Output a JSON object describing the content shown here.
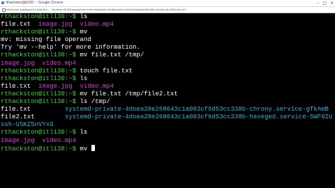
{
  "window": {
    "title": "rthackston@itl130: ~ Google Chrome",
    "url": "shell.learn.gold/apps/rt.instruction... ?student=itl130&arrangement=terminal&pwd=ssh&session=shell-rthackston&profile=tmux&cols=80&rows=24",
    "controls": [
      "–",
      "□",
      "×"
    ]
  },
  "colors": {
    "prompt": "#3fd13f",
    "file_magenta": "#d63cd6",
    "file_cyan": "#2fb4d8",
    "background": "#000000"
  },
  "terminal": {
    "lines": [
      {
        "prompt": "rthackston@itl130:~$",
        "cmd": " ls"
      },
      {
        "files": [
          {
            "t": "file.txt",
            "c": "plain"
          },
          {
            "t": "  ",
            "c": "plain"
          },
          {
            "t": "image.jpg",
            "c": "magenta"
          },
          {
            "t": "  ",
            "c": "plain"
          },
          {
            "t": "video.mp4",
            "c": "magenta"
          }
        ]
      },
      {
        "prompt": "rthackston@itl130:~$",
        "cmd": " mv"
      },
      {
        "text": "mv: missing file operand"
      },
      {
        "text": "Try 'mv --help' for more information."
      },
      {
        "prompt": "rthackston@itl130:~$",
        "cmd": " mv file.txt /tmp/"
      },
      {
        "files": [
          {
            "t": "image.jpg",
            "c": "magenta"
          },
          {
            "t": "  ",
            "c": "plain"
          },
          {
            "t": "video.mp4",
            "c": "magenta"
          }
        ]
      },
      {
        "prompt": "rthackston@itl130:~$",
        "cmd": " touch file.txt"
      },
      {
        "prompt": "rthackston@itl130:~$",
        "cmd": " ls"
      },
      {
        "files": [
          {
            "t": "file.txt",
            "c": "plain"
          },
          {
            "t": "  ",
            "c": "plain"
          },
          {
            "t": "image.jpg",
            "c": "magenta"
          },
          {
            "t": "  ",
            "c": "plain"
          },
          {
            "t": "video.mp4",
            "c": "magenta"
          }
        ]
      },
      {
        "prompt": "rthackston@itl130:~$",
        "cmd": " mv file.txt /tmp/file2.txt"
      },
      {
        "prompt": "rthackston@itl130:~$",
        "cmd": " ls /tmp/"
      },
      {
        "files": [
          {
            "t": "file.txt",
            "c": "plain"
          },
          {
            "t": "         ",
            "c": "plain"
          },
          {
            "t": "systemd-private-4doea28e268643c1a083cf6d53cc338b-chrony.service-gTkAmB",
            "c": "cyan"
          }
        ]
      },
      {
        "files": [
          {
            "t": "file2.txt",
            "c": "plain"
          },
          {
            "t": "        ",
            "c": "plain"
          },
          {
            "t": "systemd-private-4doea28e268643c1a083cf6d53cc338b-haveged.service-5WF0IU",
            "c": "cyan"
          }
        ]
      },
      {
        "files": [
          {
            "t": "ssh-USKZ5nVYxG",
            "c": "cyan"
          }
        ]
      },
      {
        "prompt": "rthackston@itl130:~$",
        "cmd": " ls"
      },
      {
        "files": [
          {
            "t": "image.jpg",
            "c": "magenta"
          },
          {
            "t": "  ",
            "c": "plain"
          },
          {
            "t": "video.mp4",
            "c": "magenta"
          }
        ]
      },
      {
        "prompt": "rthackston@itl130:~$",
        "cmd": " mv ",
        "cursor": true
      }
    ]
  }
}
